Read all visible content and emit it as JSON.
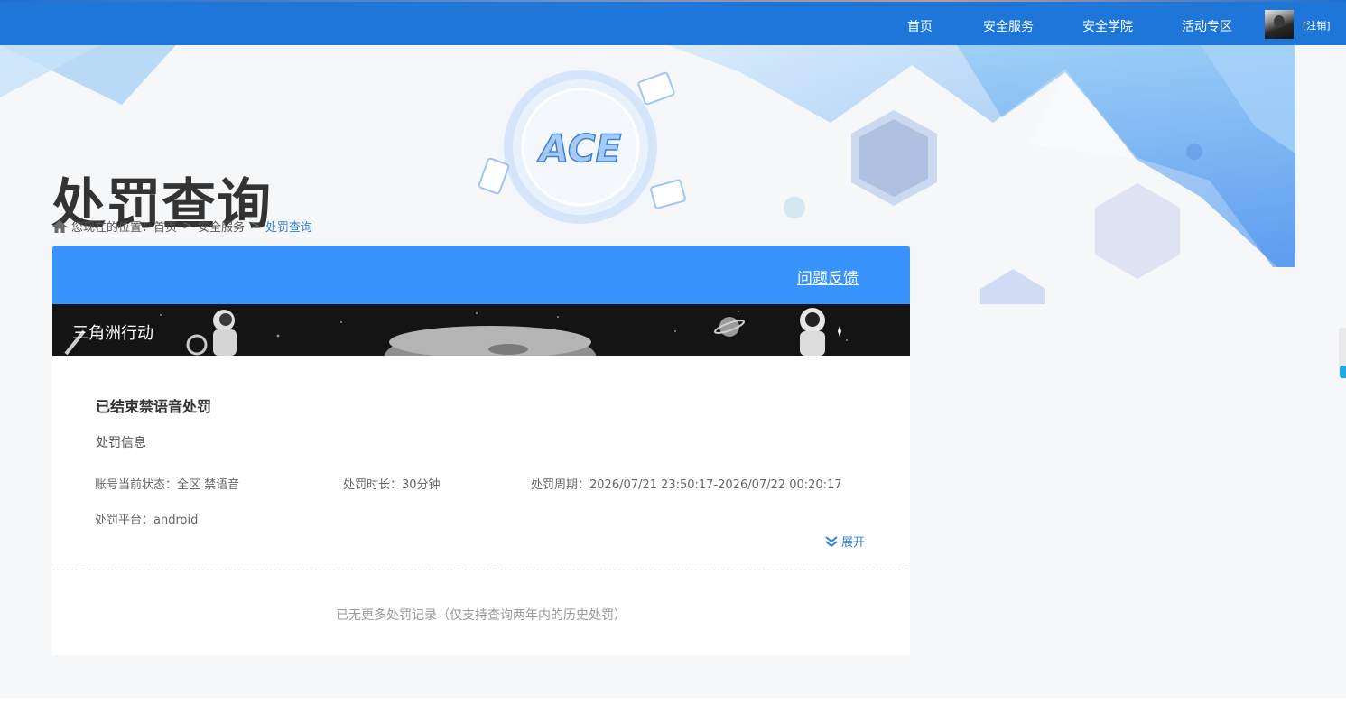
{
  "nav": {
    "items": [
      "首页",
      "安全服务",
      "安全学院",
      "活动专区"
    ],
    "logout_label": "[注销]"
  },
  "page": {
    "title": "处罚查询"
  },
  "breadcrumb": {
    "prefix": "您现在的位置：",
    "items": [
      "首页",
      "安全服务",
      "处罚查询"
    ],
    "separator": ">"
  },
  "card": {
    "feedback_label": "问题反馈",
    "game_name": "三角洲行动",
    "punishment": {
      "title": "已结束禁语音处罚",
      "section_label": "处罚信息",
      "status": "账号当前状态：全区 禁语音",
      "duration": "处罚时长：30分钟",
      "period": "处罚周期：2026/07/21 23:50:17-2026/07/22 00:20:17",
      "platform": "处罚平台：android",
      "expand_label": "展开"
    },
    "no_more_text": "已无更多处罚记录（仅支持查询两年内的历史处罚）"
  },
  "colors": {
    "nav_bg": "#1d76d8",
    "card_head_bg": "#3893fb",
    "link": "#2f84d9"
  }
}
